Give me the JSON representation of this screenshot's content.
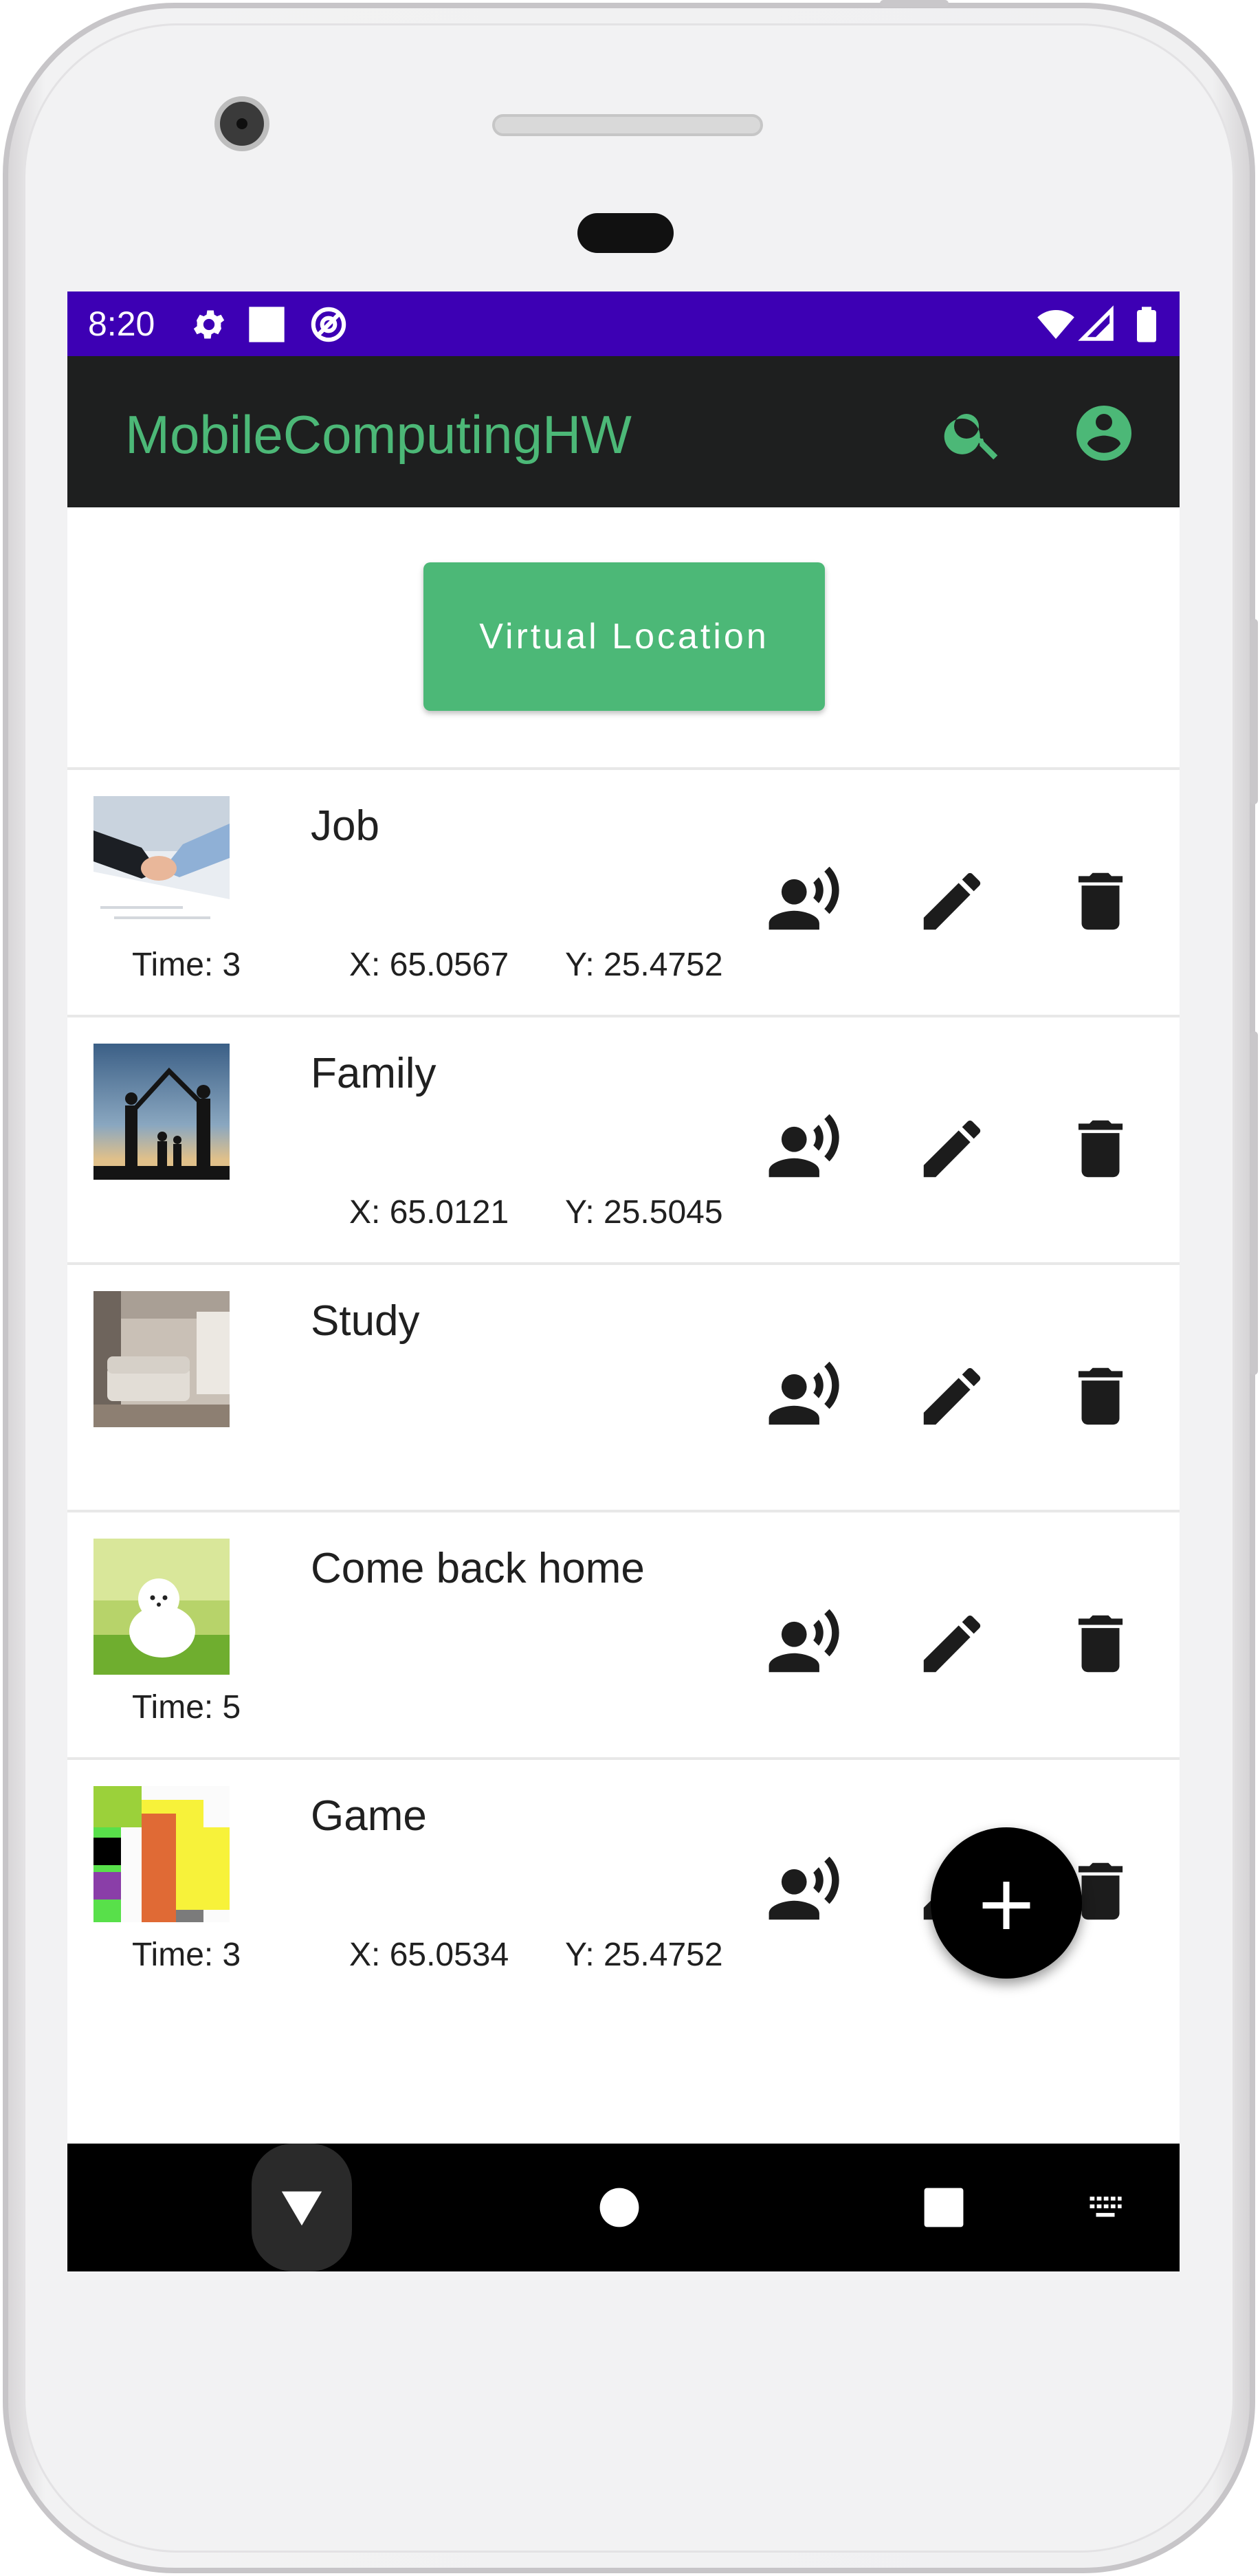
{
  "status_bar": {
    "time": "8:20"
  },
  "app_bar": {
    "title": "MobileComputingHW"
  },
  "virtual_location_button": {
    "label": "Virtual Location"
  },
  "places": [
    {
      "title": "Job",
      "time": "Time: 3",
      "x": "X: 65.0567",
      "y": "Y: 25.4752"
    },
    {
      "title": "Family",
      "time": "",
      "x": "X: 65.0121",
      "y": "Y: 25.5045"
    },
    {
      "title": "Study",
      "time": "",
      "x": "",
      "y": ""
    },
    {
      "title": "Come back home",
      "time": "Time: 5",
      "x": "",
      "y": ""
    },
    {
      "title": "Game",
      "time": "Time: 3",
      "x": "X: 65.0534",
      "y": "Y: 25.4752"
    }
  ],
  "fab": {
    "label": "+"
  },
  "colors": {
    "status_bar": "#3d00b4",
    "app_bar": "#1e1f1f",
    "accent": "#4cb877",
    "fab": "#000000",
    "nav_bar": "#000000"
  },
  "icons": {
    "status": [
      "settings-icon",
      "square-notification-icon",
      "at-sign-icon",
      "wifi-icon",
      "signal-icon",
      "battery-icon"
    ],
    "app_bar": [
      "search-icon",
      "account-circle-icon"
    ],
    "row_actions": [
      "record-voice-icon",
      "edit-pencil-icon",
      "delete-trash-icon"
    ],
    "nav": [
      "back-triangle-icon",
      "home-circle-icon",
      "recents-square-icon",
      "keyboard-icon"
    ]
  }
}
